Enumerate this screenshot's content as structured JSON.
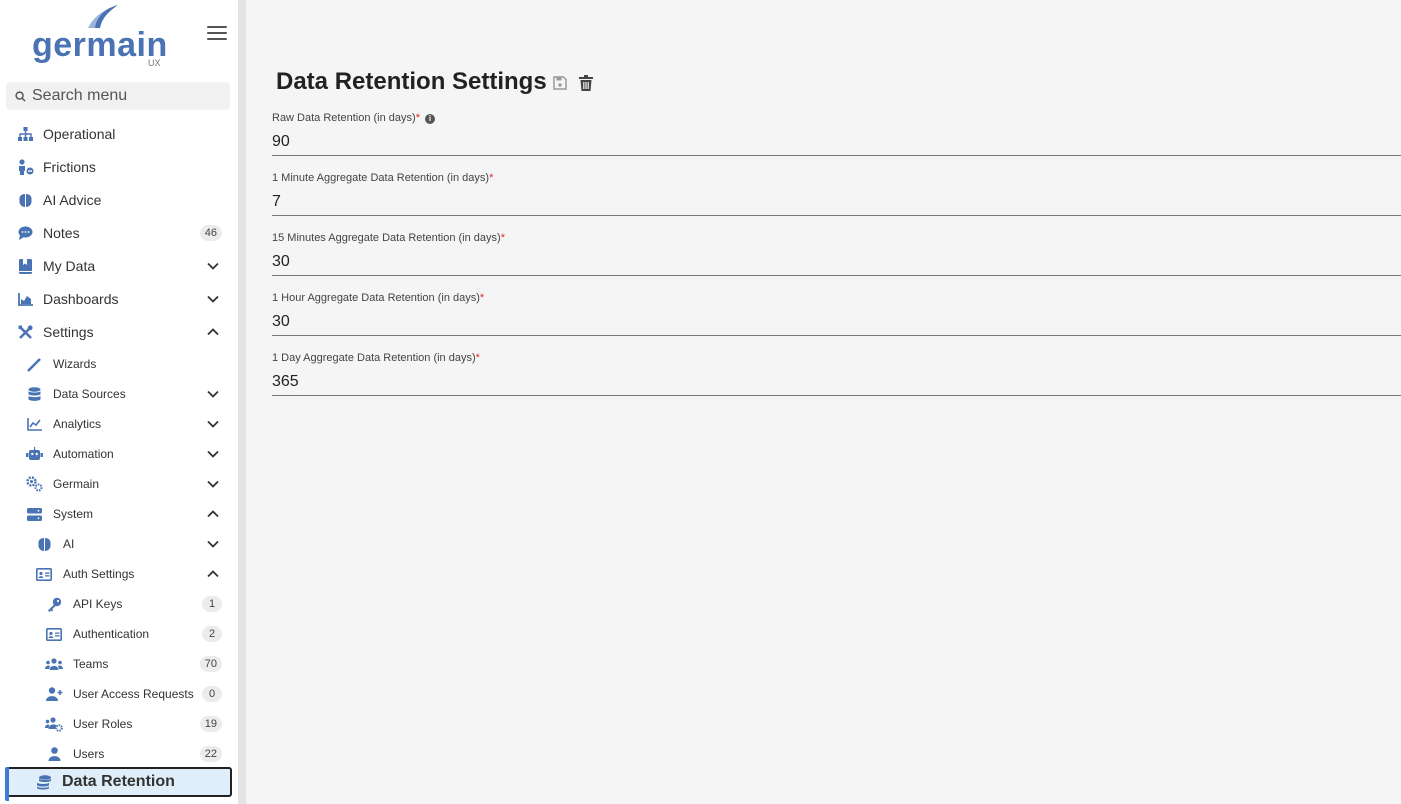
{
  "brand": {
    "name": "germain",
    "sub": "UX"
  },
  "search": {
    "placeholder": "Search menu"
  },
  "nav": [
    {
      "label": "Operational",
      "icon": "sitemap-icon"
    },
    {
      "label": "Frictions",
      "icon": "user-minus-icon"
    },
    {
      "label": "AI Advice",
      "icon": "brain-icon"
    },
    {
      "label": "Notes",
      "icon": "comment-icon",
      "badge": "46"
    },
    {
      "label": "My Data",
      "icon": "book-icon"
    },
    {
      "label": "Dashboards",
      "icon": "chart-area-icon"
    },
    {
      "label": "Settings",
      "icon": "tools-icon"
    }
  ],
  "settings": [
    {
      "label": "Wizards",
      "icon": "wand-icon"
    },
    {
      "label": "Data Sources",
      "icon": "database-icon"
    },
    {
      "label": "Analytics",
      "icon": "line-chart-icon"
    },
    {
      "label": "Automation",
      "icon": "robot-icon"
    },
    {
      "label": "Germain",
      "icon": "cogs-icon"
    },
    {
      "label": "System",
      "icon": "server-icon"
    }
  ],
  "system": [
    {
      "label": "AI",
      "icon": "brain-icon"
    },
    {
      "label": "Auth Settings",
      "icon": "id-card-icon"
    }
  ],
  "auth": [
    {
      "label": "API Keys",
      "icon": "key-icon",
      "badge": "1"
    },
    {
      "label": "Authentication",
      "icon": "id-card-icon",
      "badge": "2"
    },
    {
      "label": "Teams",
      "icon": "users-icon",
      "badge": "70"
    },
    {
      "label": "User Access Requests",
      "icon": "user-plus-icon",
      "badge": "0"
    },
    {
      "label": "User Roles",
      "icon": "users-cog-icon",
      "badge": "19"
    },
    {
      "label": "Users",
      "icon": "user-icon",
      "badge": "22"
    }
  ],
  "active": {
    "label": "Data Retention",
    "icon": "coins-icon"
  },
  "page": {
    "title": "Data Retention Settings",
    "fields": [
      {
        "label": "Raw Data Retention (in days)",
        "value": "90"
      },
      {
        "label": "1 Minute Aggregate Data Retention (in days)",
        "value": "7"
      },
      {
        "label": "15 Minutes Aggregate Data Retention (in days)",
        "value": "30"
      },
      {
        "label": "1 Hour Aggregate Data Retention (in days)",
        "value": "30"
      },
      {
        "label": "1 Day Aggregate Data Retention (in days)",
        "value": "365"
      }
    ],
    "required_mark": "*",
    "info_mark": "i"
  },
  "colors": {
    "icon": "#4a73b3",
    "accent": "#3a7bd5",
    "required": "#d32f2f"
  }
}
